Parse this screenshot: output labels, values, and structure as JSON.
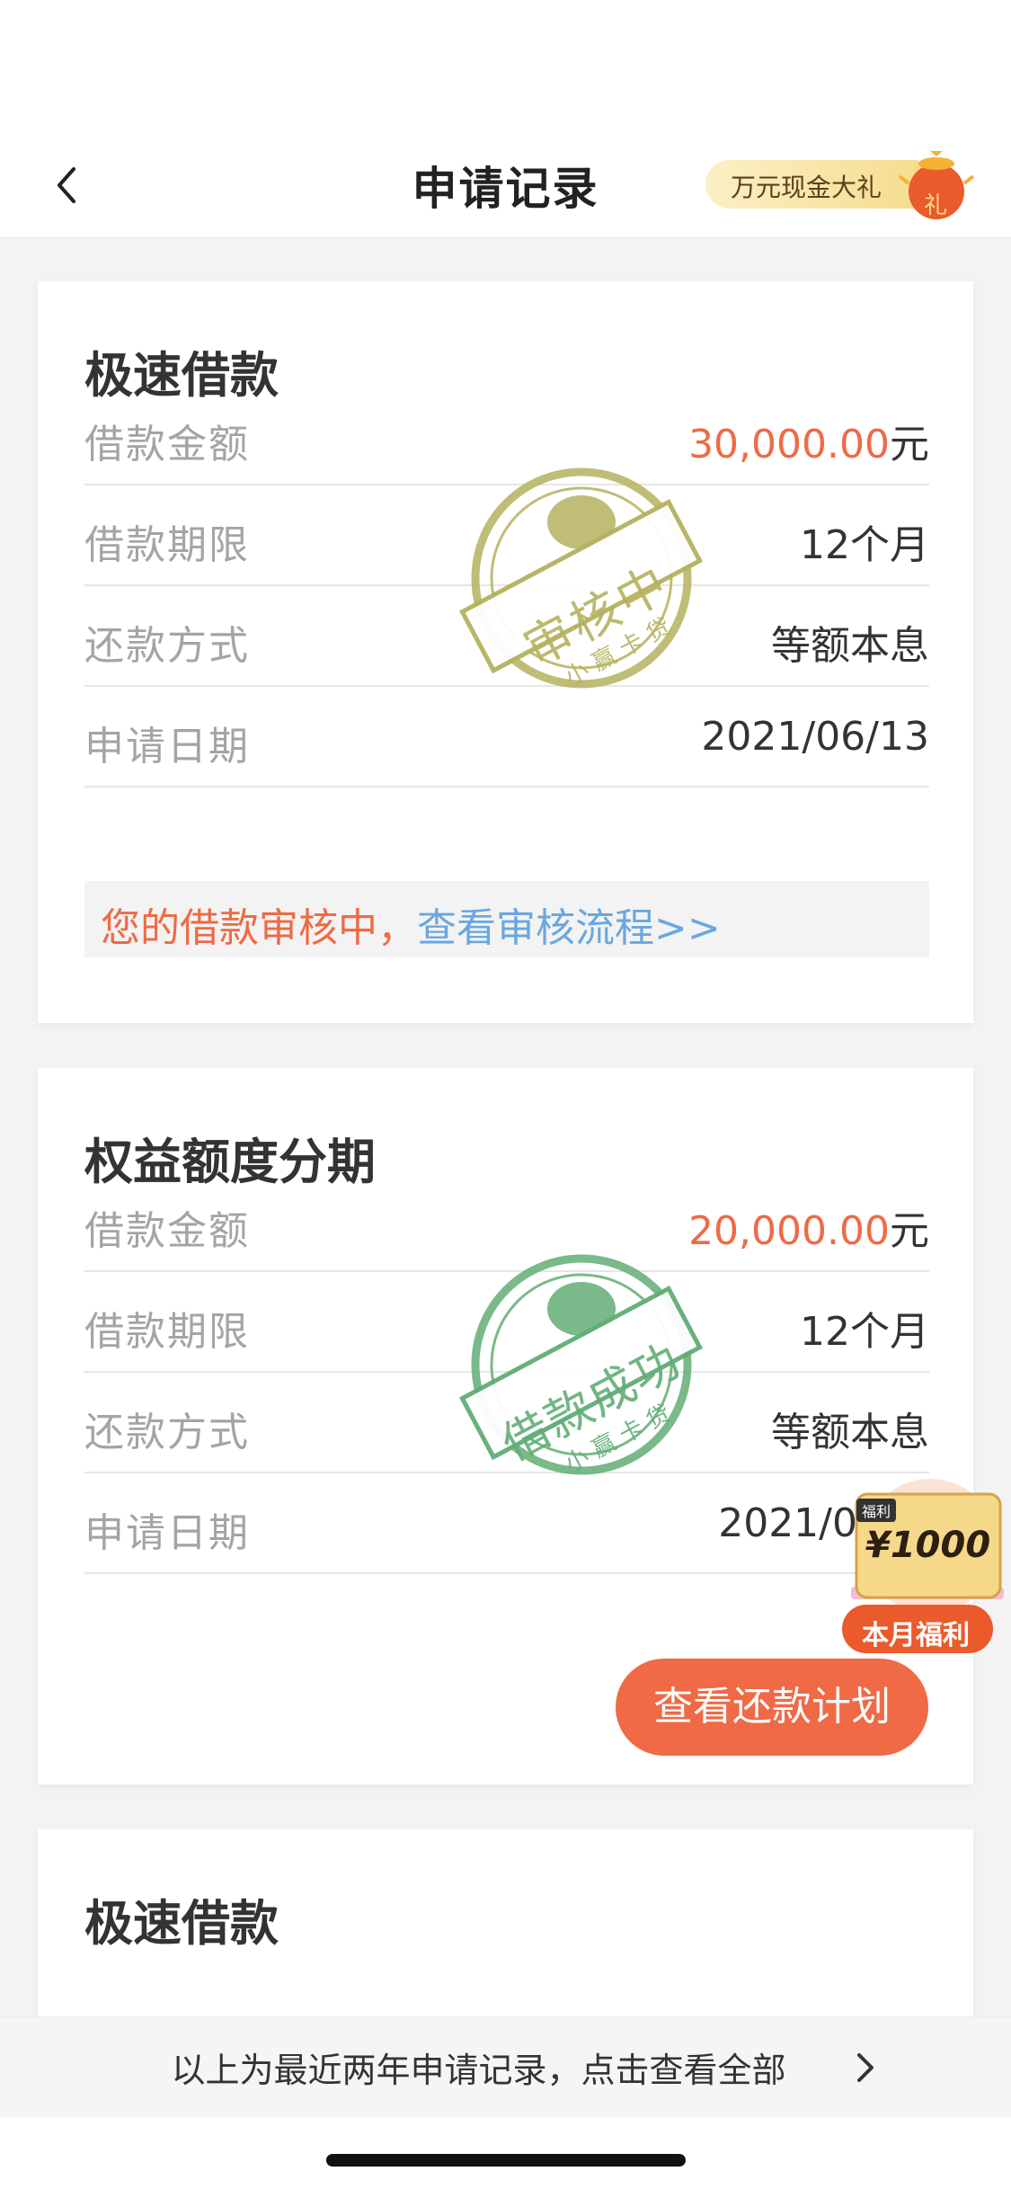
{
  "header": {
    "title": "申请记录",
    "promo_label": "万元现金大礼",
    "promo_bag_char": "礼"
  },
  "records": [
    {
      "title": "极速借款",
      "stamp_text": "审核中",
      "stamp_brand": "小 赢 卡 贷",
      "stamp_color": "#b5b25f",
      "rows": [
        {
          "label": "借款金额",
          "amount": "30,000.00",
          "unit": "元"
        },
        {
          "label": "借款期限",
          "value": "12个月"
        },
        {
          "label": "还款方式",
          "value": "等额本息"
        },
        {
          "label": "申请日期",
          "value": "2021/06/13"
        }
      ],
      "notice_text": "您的借款审核中，",
      "notice_link": "查看审核流程>>"
    },
    {
      "title": "权益额度分期",
      "stamp_text": "借款成功",
      "stamp_brand": "小 赢 卡 贷",
      "stamp_color": "#62ad76",
      "rows": [
        {
          "label": "借款金额",
          "amount": "20,000.00",
          "unit": "元"
        },
        {
          "label": "借款期限",
          "value": "12个月"
        },
        {
          "label": "还款方式",
          "value": "等额本息"
        },
        {
          "label": "申请日期",
          "value": "2021/0"
        }
      ],
      "button_label": "查看还款计划"
    },
    {
      "title": "极速借款"
    }
  ],
  "welfare_badge": {
    "tag": "福利",
    "amount": "¥1000",
    "label": "本月福利"
  },
  "footer": {
    "text": "以上为最近两年申请记录，点击查看全部"
  },
  "colors": {
    "accent": "#ef6a45",
    "link": "#6aa7e0"
  }
}
